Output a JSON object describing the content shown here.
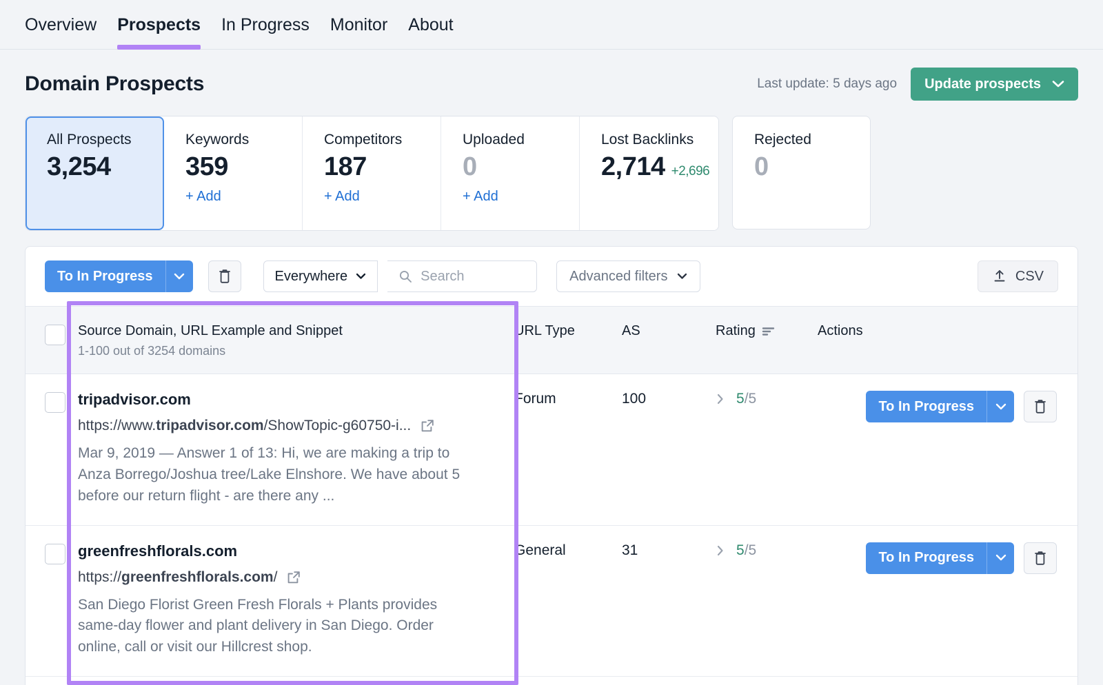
{
  "nav": {
    "tabs": [
      {
        "label": "Overview",
        "active": false
      },
      {
        "label": "Prospects",
        "active": true
      },
      {
        "label": "In Progress",
        "active": false
      },
      {
        "label": "Monitor",
        "active": false
      },
      {
        "label": "About",
        "active": false
      }
    ]
  },
  "header": {
    "title": "Domain Prospects",
    "last_update": "Last update: 5 days ago",
    "update_button": "Update prospects"
  },
  "cards": [
    {
      "label": "All Prospects",
      "value": "3,254",
      "delta": "",
      "add": "",
      "active": true,
      "zero": false,
      "standalone": false
    },
    {
      "label": "Keywords",
      "value": "359",
      "delta": "",
      "add": "+ Add",
      "active": false,
      "zero": false,
      "standalone": false
    },
    {
      "label": "Competitors",
      "value": "187",
      "delta": "",
      "add": "+ Add",
      "active": false,
      "zero": false,
      "standalone": false
    },
    {
      "label": "Uploaded",
      "value": "0",
      "delta": "",
      "add": "+ Add",
      "active": false,
      "zero": true,
      "standalone": false
    },
    {
      "label": "Lost Backlinks",
      "value": "2,714",
      "delta": "+2,696",
      "add": "",
      "active": false,
      "zero": false,
      "standalone": false
    },
    {
      "label": "Rejected",
      "value": "0",
      "delta": "",
      "add": "",
      "active": false,
      "zero": true,
      "standalone": true
    }
  ],
  "toolbar": {
    "to_in_progress": "To In Progress",
    "scope_select": "Everywhere",
    "search_placeholder": "Search",
    "search_value": "",
    "advanced_filters": "Advanced filters",
    "csv": "CSV",
    "delete_icon": "trash-icon",
    "upload_icon": "upload-icon"
  },
  "table": {
    "headers": {
      "source": "Source Domain, URL Example and Snippet",
      "source_sub": "1-100 out of 3254 domains",
      "url_type": "URL Type",
      "as": "AS",
      "rating": "Rating",
      "actions": "Actions"
    },
    "rows": [
      {
        "domain": "tripadvisor.com",
        "url_prefix": "https://www.",
        "url_bold": "tripadvisor.com",
        "url_suffix": "/ShowTopic-g60750-i...",
        "snippet": "Mar 9, 2019 — Answer 1 of 13: Hi, we are making a trip to Anza Borrego/Joshua tree/Lake Elnshore. We have about 5 before our return flight - are there any ...",
        "url_type": "Forum",
        "as": "100",
        "rating_value": "5",
        "rating_max": "/5",
        "action_label": "To In Progress"
      },
      {
        "domain": "greenfreshflorals.com",
        "url_prefix": "https://",
        "url_bold": "greenfreshflorals.com",
        "url_suffix": "/",
        "snippet": "San Diego Florist Green Fresh Florals + Plants provides same-day flower and plant delivery in San Diego. Order online, call or visit our Hillcrest shop.",
        "url_type": "General",
        "as": "31",
        "rating_value": "5",
        "rating_max": "/5",
        "action_label": "To In Progress"
      }
    ]
  },
  "colors": {
    "accent_purple": "#b183f5",
    "primary_blue": "#4a90e8",
    "green": "#41a287",
    "link_blue": "#1f6fd4",
    "rating_green": "#2f8a6e"
  }
}
